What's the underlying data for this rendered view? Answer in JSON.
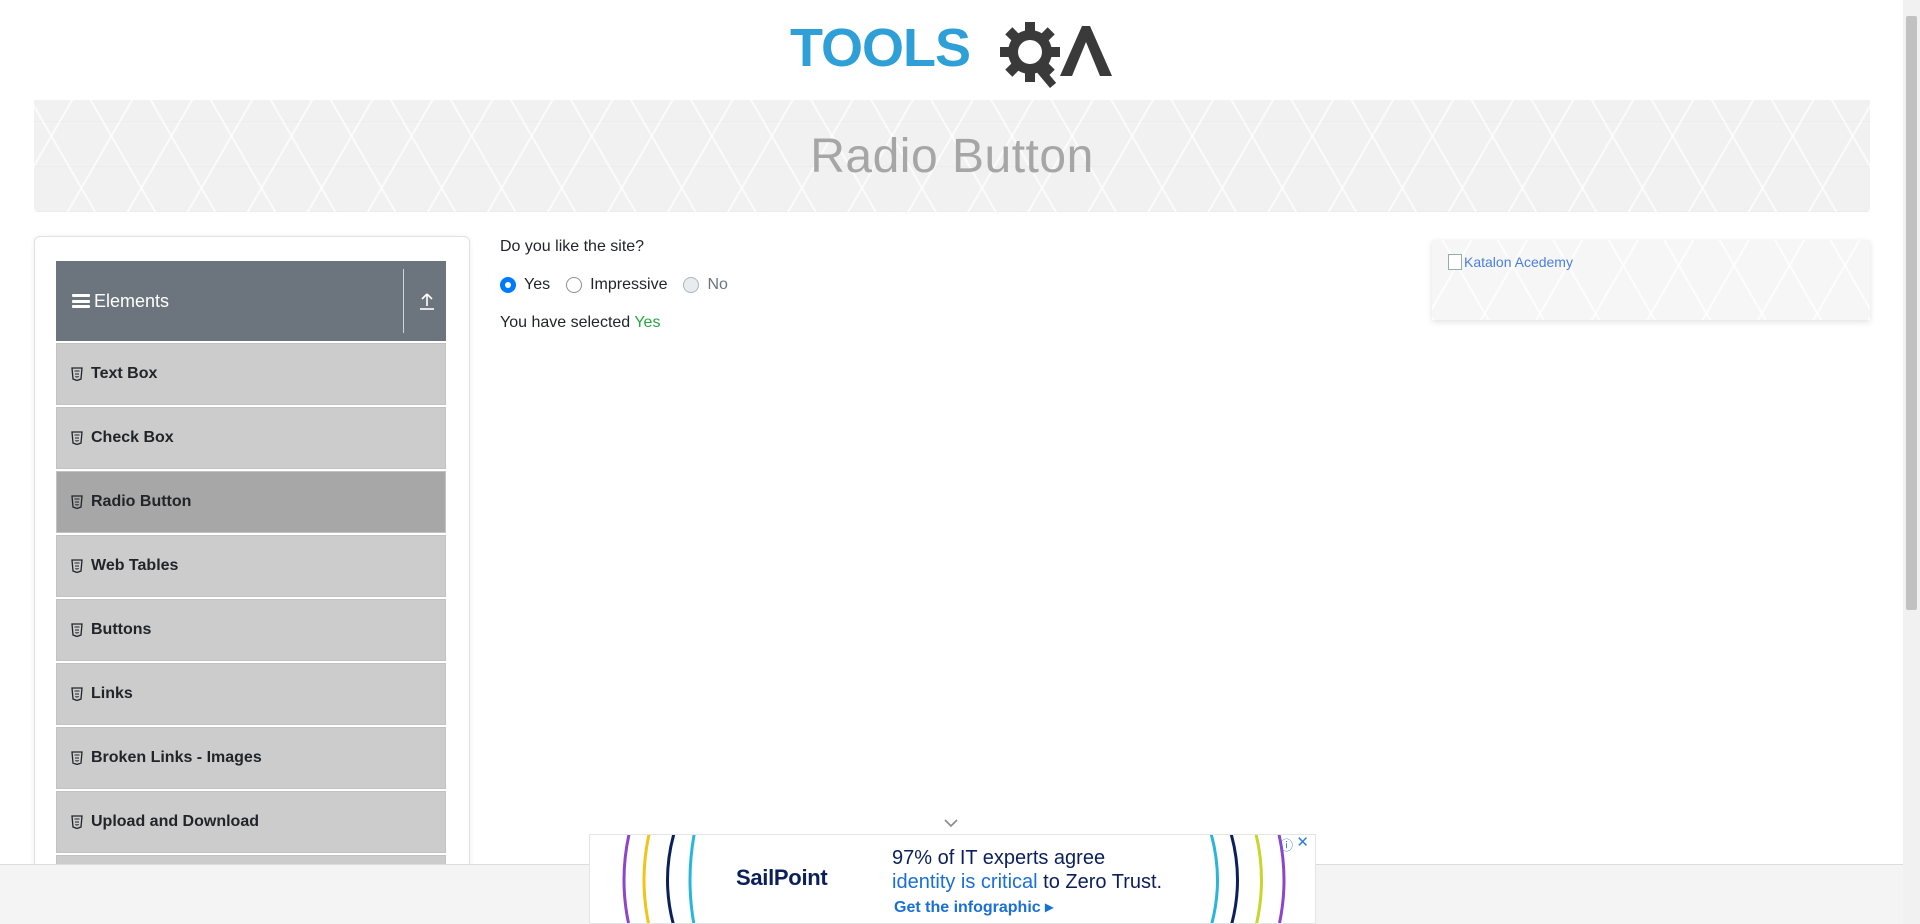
{
  "header": {
    "logo_text": "TOOLSQA"
  },
  "banner": {
    "title": "Radio Button"
  },
  "sidebar": {
    "group_title": "Elements",
    "items": [
      {
        "label": "Text Box",
        "active": false
      },
      {
        "label": "Check Box",
        "active": false
      },
      {
        "label": "Radio Button",
        "active": true
      },
      {
        "label": "Web Tables",
        "active": false
      },
      {
        "label": "Buttons",
        "active": false
      },
      {
        "label": "Links",
        "active": false
      },
      {
        "label": "Broken Links - Images",
        "active": false
      },
      {
        "label": "Upload and Download",
        "active": false
      }
    ]
  },
  "main": {
    "question": "Do you like the site?",
    "options": [
      {
        "label": "Yes",
        "state": "checked"
      },
      {
        "label": "Impressive",
        "state": "unchecked"
      },
      {
        "label": "No",
        "state": "disabled"
      }
    ],
    "result_prefix": "You have selected ",
    "result_value": "Yes"
  },
  "right_ad": {
    "alt_text": "Katalon Acedemy"
  },
  "bottom_ad": {
    "brand": "SailPoint",
    "line1": "97% of IT experts agree",
    "line2_emphasis": "identity is critical",
    "line2_rest": " to Zero Trust.",
    "cta": "Get the infographic ▸",
    "adchoices_icon": "info-icon",
    "close_icon": "close-icon"
  },
  "colors": {
    "accent": "#007bff",
    "success": "#28a745",
    "sidebar_header": "#6c757d",
    "menu_item": "#cccccc",
    "menu_item_active": "#a7a7a7"
  }
}
